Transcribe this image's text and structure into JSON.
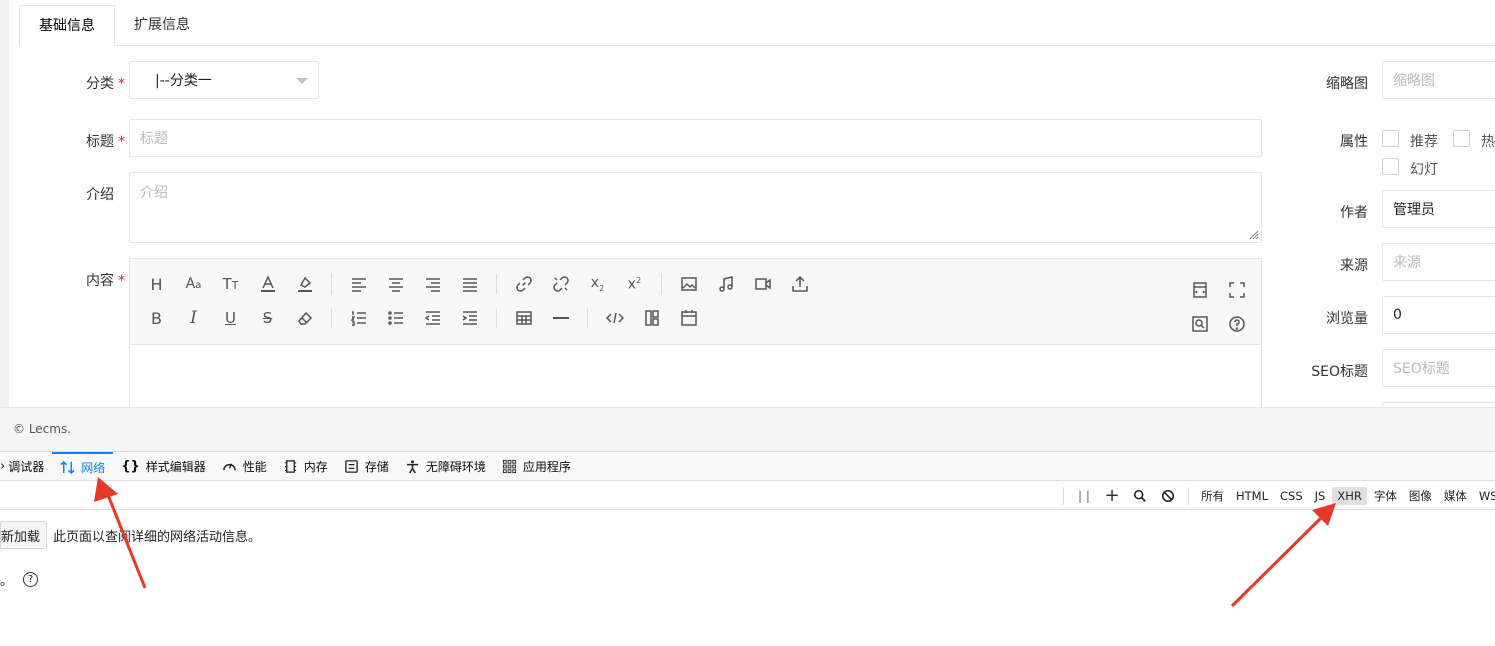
{
  "form_tabs": {
    "basic": "基础信息",
    "extended": "扩展信息"
  },
  "fields": {
    "category": {
      "label": "分类",
      "required_mark": "*",
      "value": "|--分类一"
    },
    "title": {
      "label": "标题",
      "required_mark": "*",
      "placeholder": "标题"
    },
    "intro": {
      "label": "介绍",
      "placeholder": "介绍"
    },
    "content": {
      "label": "内容",
      "required_mark": "*"
    }
  },
  "editor": {
    "row1": [
      "heading-icon",
      "font-size-icon",
      "text-size-icon",
      "font-color-icon",
      "background-color-icon",
      "align-left-icon",
      "align-center-icon",
      "align-right-icon",
      "align-justify-icon",
      "link-icon",
      "unlink-icon",
      "subscript-icon",
      "superscript-icon",
      "image-icon",
      "music-icon",
      "video-icon",
      "upload-icon"
    ],
    "row2": [
      "bold-icon",
      "italic-icon",
      "underline-icon",
      "strikethrough-icon",
      "eraser-icon",
      "ordered-list-icon",
      "unordered-list-icon",
      "outdent-icon",
      "indent-icon",
      "table-icon",
      "horizontal-rule-icon",
      "code-icon",
      "layout-icon",
      "calendar-icon"
    ],
    "right_row1": [
      "html-source-icon",
      "fullscreen-icon"
    ],
    "right_row2": [
      "search-replace-icon",
      "help-icon"
    ]
  },
  "side": {
    "thumbnail": {
      "label": "缩略图",
      "placeholder": "缩略图"
    },
    "attributes": {
      "label": "属性",
      "options": [
        "推荐",
        "热",
        "幻灯"
      ]
    },
    "author": {
      "label": "作者",
      "value": "管理员"
    },
    "source": {
      "label": "来源",
      "placeholder": "来源"
    },
    "views": {
      "label": "浏览量",
      "value": "0"
    },
    "seo_title": {
      "label": "SEO标题",
      "placeholder": "SEO标题"
    }
  },
  "footer": {
    "copyright": "© Lecms."
  },
  "devtools": {
    "tabs": [
      {
        "label": "调试器",
        "icon": "debugger-icon"
      },
      {
        "label": "网络",
        "icon": "network-icon",
        "active": true
      },
      {
        "label": "样式编辑器",
        "icon": "braces-icon"
      },
      {
        "label": "性能",
        "icon": "gauge-icon"
      },
      {
        "label": "内存",
        "icon": "memory-icon"
      },
      {
        "label": "存储",
        "icon": "storage-icon"
      },
      {
        "label": "无障碍环境",
        "icon": "accessibility-icon"
      },
      {
        "label": "应用程序",
        "icon": "grid-icon"
      }
    ],
    "filters": [
      "所有",
      "HTML",
      "CSS",
      "JS",
      "XHR",
      "字体",
      "图像",
      "媒体",
      "WS"
    ],
    "active_filter": "XHR",
    "reload_button": "重新加载",
    "reload_message": "此页面以查阅详细的网络活动信息。",
    "hint_tail": "。"
  },
  "colors": {
    "accent": "#0a84ff",
    "required": "#e02020",
    "arrow": "#e8382a"
  }
}
